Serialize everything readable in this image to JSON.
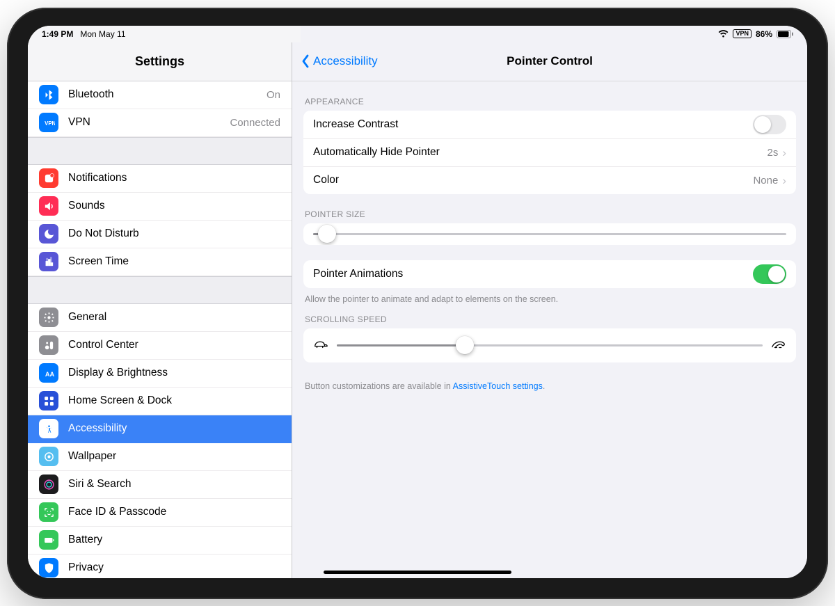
{
  "status": {
    "time": "1:49 PM",
    "date": "Mon May 11",
    "vpn_label": "VPN",
    "battery_pct": "86%"
  },
  "sidebar": {
    "title": "Settings",
    "groups": [
      [
        {
          "key": "bluetooth",
          "label": "Bluetooth",
          "value": "On",
          "icon": "bluetooth",
          "bg": "#007aff"
        },
        {
          "key": "vpn",
          "label": "VPN",
          "value": "Connected",
          "icon": "vpn",
          "bg": "#007aff"
        }
      ],
      [
        {
          "key": "notifications",
          "label": "Notifications",
          "icon": "notifications",
          "bg": "#ff3b30"
        },
        {
          "key": "sounds",
          "label": "Sounds",
          "icon": "sounds",
          "bg": "#ff2d55"
        },
        {
          "key": "dnd",
          "label": "Do Not Disturb",
          "icon": "dnd",
          "bg": "#5856d6"
        },
        {
          "key": "screentime",
          "label": "Screen Time",
          "icon": "screentime",
          "bg": "#5856d6"
        }
      ],
      [
        {
          "key": "general",
          "label": "General",
          "icon": "general",
          "bg": "#8e8e93"
        },
        {
          "key": "controlcenter",
          "label": "Control Center",
          "icon": "controlcenter",
          "bg": "#8e8e93"
        },
        {
          "key": "display",
          "label": "Display & Brightness",
          "icon": "display",
          "bg": "#007aff"
        },
        {
          "key": "homescreen",
          "label": "Home Screen & Dock",
          "icon": "homescreen",
          "bg": "#2850d8"
        },
        {
          "key": "accessibility",
          "label": "Accessibility",
          "icon": "accessibility",
          "bg": "#007aff",
          "selected": true
        },
        {
          "key": "wallpaper",
          "label": "Wallpaper",
          "icon": "wallpaper",
          "bg": "#55bef0"
        },
        {
          "key": "siri",
          "label": "Siri & Search",
          "icon": "siri",
          "bg": "#1c1c1e"
        },
        {
          "key": "faceid",
          "label": "Face ID & Passcode",
          "icon": "faceid",
          "bg": "#34c759"
        },
        {
          "key": "battery",
          "label": "Battery",
          "icon": "battery",
          "bg": "#34c759"
        },
        {
          "key": "privacy",
          "label": "Privacy",
          "icon": "privacy",
          "bg": "#007aff"
        }
      ]
    ]
  },
  "detail": {
    "back_label": "Accessibility",
    "title": "Pointer Control",
    "appearance_label": "APPEARANCE",
    "increase_contrast_label": "Increase Contrast",
    "increase_contrast_on": false,
    "auto_hide_label": "Automatically Hide Pointer",
    "auto_hide_value": "2s",
    "color_label": "Color",
    "color_value": "None",
    "pointer_size_label": "POINTER SIZE",
    "pointer_size_pct": 3,
    "pointer_anim_label": "Pointer Animations",
    "pointer_anim_on": true,
    "pointer_anim_caption": "Allow the pointer to animate and adapt to elements on the screen.",
    "scrolling_speed_label": "SCROLLING SPEED",
    "scrolling_speed_pct": 30,
    "footer_text": "Button customizations are available in ",
    "footer_link": "AssistiveTouch settings",
    "footer_period": "."
  }
}
